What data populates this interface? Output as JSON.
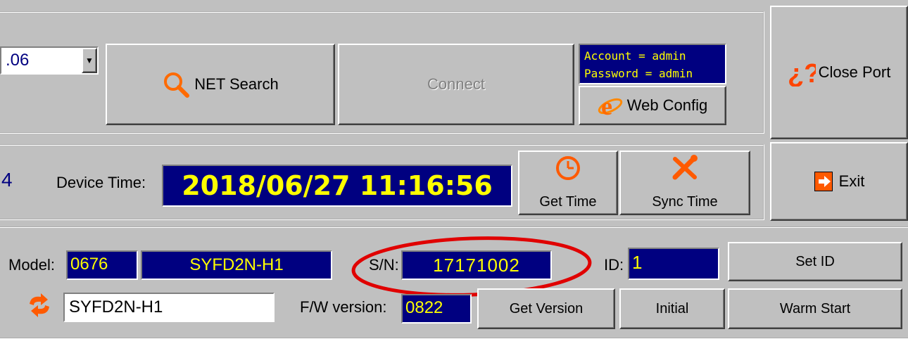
{
  "connection": {
    "ip_suffix": ".06",
    "net_search_label": "NET Search",
    "connect_label": "Connect",
    "credentials": {
      "account": "Account = admin",
      "password": "Password = admin"
    },
    "web_config_label": "Web Config"
  },
  "side": {
    "close_port_label": "Close Port",
    "exit_label": "Exit"
  },
  "time": {
    "left_fragment": "4",
    "device_time_label": "Device Time:",
    "device_time_value": "2018/06/27 11:16:56",
    "get_time_label": "Get Time",
    "sync_time_label": "Sync Time"
  },
  "device": {
    "model_label": "Model:",
    "model_code": "0676",
    "model_name": "SYFD2N-H1",
    "sn_label": "S/N:",
    "sn_value": "17171002",
    "id_label": "ID:",
    "id_value": "1",
    "set_id_label": "Set ID",
    "name_input_value": "SYFD2N-H1",
    "fw_label": "F/W version:",
    "fw_value": "0822",
    "get_version_label": "Get Version",
    "initial_label": "Initial",
    "warm_start_label": "Warm Start"
  },
  "colors": {
    "face": "#c0c0c0",
    "navy_field": "#000080",
    "field_text": "#ffff00",
    "accent_orange": "#ff6a00",
    "highlight_ellipse": "#e00000"
  }
}
